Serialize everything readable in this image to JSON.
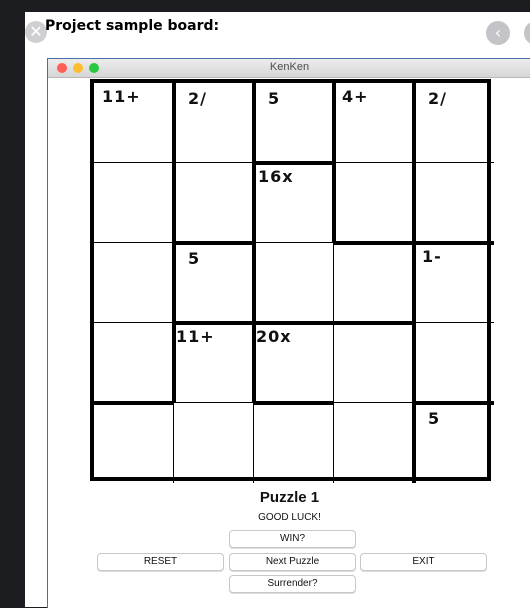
{
  "page": {
    "title": "Project sample board:"
  },
  "window": {
    "title": "KenKen"
  },
  "board": {
    "size": 5,
    "cages": [
      {
        "label": "11+"
      },
      {
        "label": "2/"
      },
      {
        "label": "5"
      },
      {
        "label": "4+"
      },
      {
        "label": "2/"
      },
      {
        "label": "16x"
      },
      {
        "label": "5"
      },
      {
        "label": "1-"
      },
      {
        "label": "11+"
      },
      {
        "label": "20x"
      },
      {
        "label": "5"
      }
    ]
  },
  "game": {
    "puzzle_name": "Puzzle 1",
    "status": "GOOD LUCK!"
  },
  "buttons": {
    "win": "WIN?",
    "reset": "RESET",
    "next": "Next Puzzle",
    "exit": "EXIT",
    "surrender": "Surrender?"
  },
  "icons": {
    "close": "close-icon",
    "back": "chevron-left-icon",
    "forward": "chevron-right-icon"
  },
  "colors": {
    "background": "#1c1d21",
    "traffic_red": "#ff5f57",
    "traffic_yellow": "#febc2e",
    "traffic_green": "#28c840"
  }
}
